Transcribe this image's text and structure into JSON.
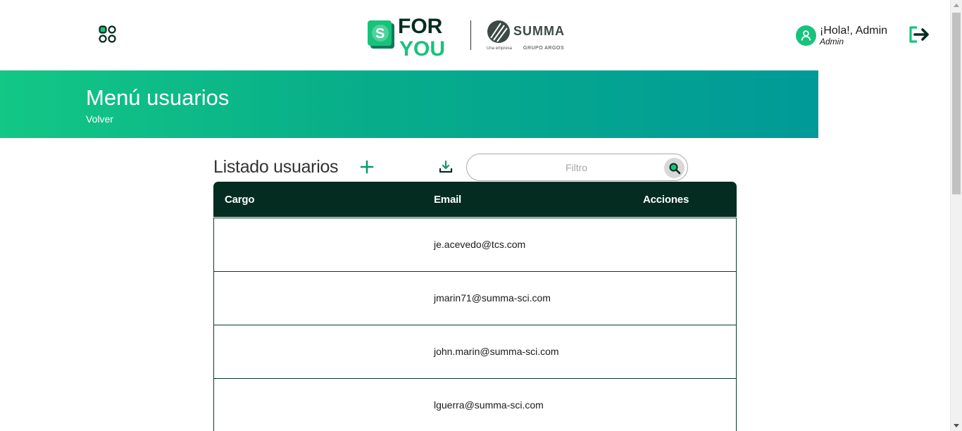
{
  "header": {
    "user_greeting": "¡Hola!, Admin",
    "user_role": "Admin",
    "logo_left_text": [
      "FOR",
      "YOU"
    ],
    "logo_right_text": "SUMMA",
    "logo_right_sub1": "Una empresa",
    "logo_right_sub2": "GRUPO ARGOS"
  },
  "banner": {
    "title": "Menú usuarios",
    "back_label": "Volver"
  },
  "toolbar": {
    "list_title": "Listado usuarios",
    "filter_placeholder": "Filtro"
  },
  "table": {
    "columns": [
      "Cargo",
      "Email",
      "Acciones"
    ],
    "rows": [
      {
        "cargo": "",
        "email": "je.acevedo@tcs.com",
        "acciones": ""
      },
      {
        "cargo": "",
        "email": "jmarin71@summa-sci.com",
        "acciones": ""
      },
      {
        "cargo": "",
        "email": "john.marin@summa-sci.com",
        "acciones": ""
      },
      {
        "cargo": "",
        "email": "lguerra@summa-sci.com",
        "acciones": ""
      }
    ]
  },
  "icons": {
    "apps": "apps-grid-icon",
    "user": "user-icon",
    "logout": "logout-icon",
    "add": "plus-icon",
    "download": "download-icon",
    "search": "search-icon"
  },
  "colors": {
    "brand_green": "#17c37b",
    "dark_green": "#042c20",
    "banner_start": "#13c785",
    "banner_end": "#009a98"
  }
}
